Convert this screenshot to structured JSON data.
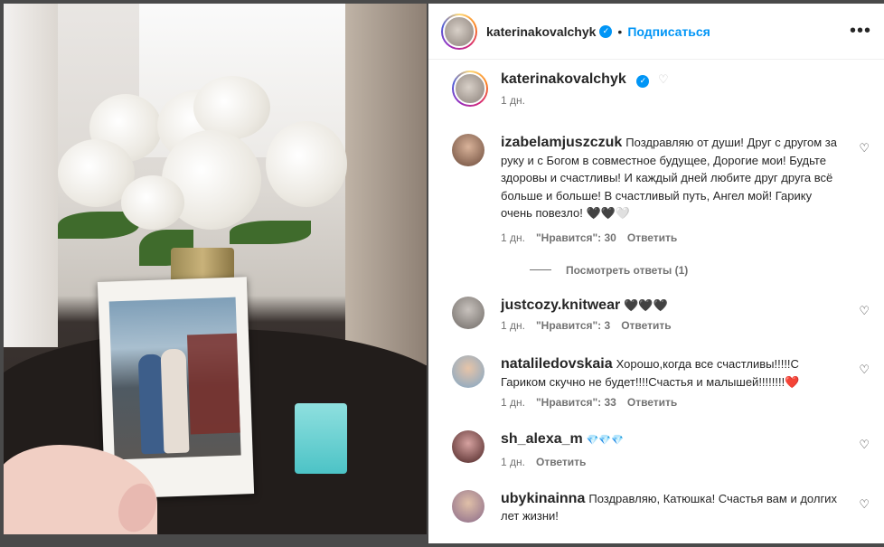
{
  "post": {
    "username": "katerinakovalchyk",
    "follow_label": "Подписаться",
    "more_icon": "more-horizontal-icon",
    "caption_time": "1 дн."
  },
  "comments": [
    {
      "username": "izabelamjuszczuk",
      "text": "Поздравляю от души! Друг с другом за руку и с Богом в совместное будущее, Дорогие мои! Будьте здоровы и счастливы! И каждый дней любите друг друга всё больше и больше! В счастливый путь, Ангел мой! Гарику очень повезло! 🖤🖤🤍",
      "time": "1 дн.",
      "likes": "\"Нравится\": 30",
      "reply": "Ответить",
      "view_replies": "Посмотреть ответы (1)"
    },
    {
      "username": "justcozy.knitwear",
      "text": "🖤🖤🖤",
      "time": "1 дн.",
      "likes": "\"Нравится\": 3",
      "reply": "Ответить"
    },
    {
      "username": "nataliledovskaia",
      "text": "Хорошо,когда все счастливы!!!!!С Гариком скучно не будет!!!!Счастья и малышей!!!!!!!!❤️",
      "time": "1 дн.",
      "likes": "\"Нравится\": 33",
      "reply": "Ответить"
    },
    {
      "username": "sh_alexa_m",
      "text": "💎💎💎",
      "time": "1 дн.",
      "reply": "Ответить"
    },
    {
      "username": "ubykinainna",
      "text": "Поздравляю, Катюшка! Счастья вам и долгих лет жизни!"
    }
  ],
  "colors": {
    "accent": "#0095f6",
    "text": "#262626",
    "muted": "#737373"
  }
}
